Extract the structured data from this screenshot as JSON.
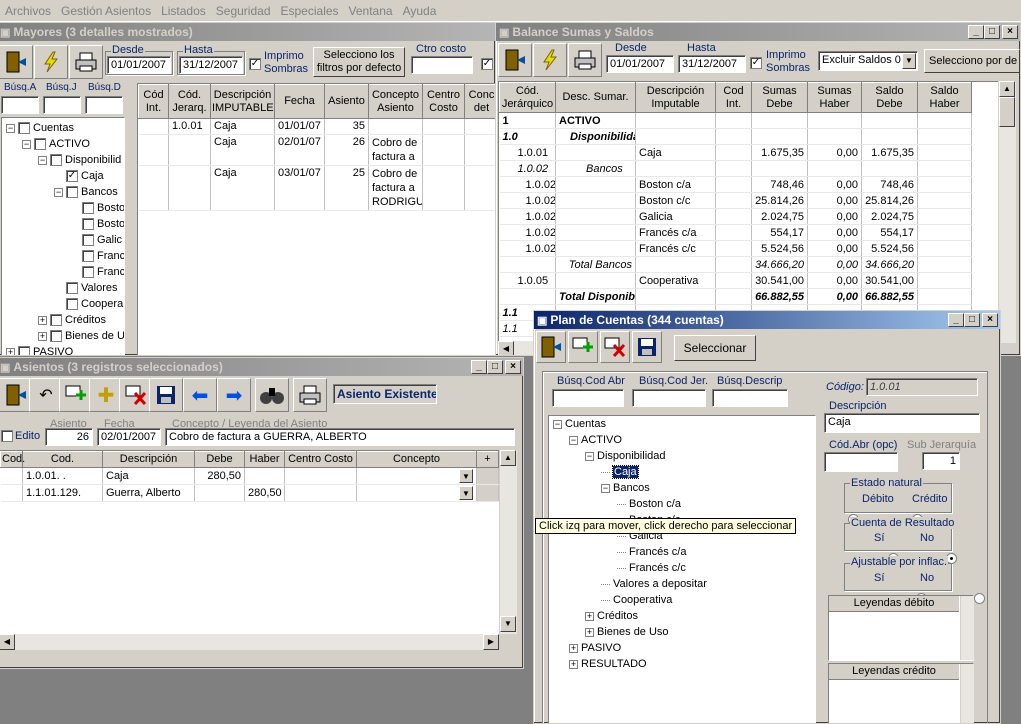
{
  "menu": [
    "Archivos",
    "Gestión Asientos",
    "Listados",
    "Seguridad",
    "Especiales",
    "Ventana",
    "Ayuda"
  ],
  "mayores": {
    "title": "Mayores (3 detalles mostrados)",
    "desde_label": "Desde",
    "desde": "01/01/2007",
    "hasta_label": "Hasta",
    "hasta": "31/12/2007",
    "imprimo_label": "Imprimo Sombras",
    "filtros_button": "Selecciono los filtros por defecto",
    "ctro_costo_label": "Ctro costo",
    "busq_labels": [
      "Búsq.A",
      "Búsq.J",
      "Búsq.D"
    ],
    "tree": [
      {
        "label": "Cuentas",
        "checked": false,
        "exp": "−"
      },
      {
        "label": "ACTIVO",
        "checked": false,
        "exp": "−"
      },
      {
        "label": "Disponibilid",
        "checked": false,
        "exp": "−"
      },
      {
        "label": "Caja",
        "checked": true,
        "exp": ""
      },
      {
        "label": "Bancos",
        "checked": false,
        "exp": "−"
      },
      {
        "label": "Bosto",
        "checked": false,
        "exp": ""
      },
      {
        "label": "Bosto",
        "checked": false,
        "exp": ""
      },
      {
        "label": "Galic",
        "checked": false,
        "exp": ""
      },
      {
        "label": "Franc",
        "checked": false,
        "exp": ""
      },
      {
        "label": "Franc",
        "checked": false,
        "exp": ""
      },
      {
        "label": "Valores",
        "checked": false,
        "exp": ""
      },
      {
        "label": "Coopera",
        "checked": false,
        "exp": ""
      },
      {
        "label": "Créditos",
        "checked": false,
        "exp": "+"
      },
      {
        "label": "Bienes de U",
        "checked": false,
        "exp": "+"
      },
      {
        "label": "PASIVO",
        "checked": false,
        "exp": "+"
      }
    ],
    "columns": [
      "Cód Int.",
      "Cód. Jerarq.",
      "Descripción IMPUTABLE",
      "Fecha",
      "Asiento",
      "Concepto Asiento",
      "Centro Costo",
      "Conc det"
    ],
    "rows": [
      {
        "int": "",
        "jer": "1.0.01",
        "desc": "Caja",
        "fecha": "01/01/07",
        "asiento": "35",
        "concepto": "",
        "centro": ""
      },
      {
        "int": "",
        "jer": "",
        "desc": "Caja",
        "fecha": "02/01/07",
        "asiento": "26",
        "concepto": "Cobro de factura a",
        "centro": ""
      },
      {
        "int": "",
        "jer": "",
        "desc": "Caja",
        "fecha": "03/01/07",
        "asiento": "25",
        "concepto": "Cobro de factura a RODRIGU",
        "centro": ""
      }
    ]
  },
  "balance": {
    "title": "Balance Sumas y Saldos",
    "desde_label": "Desde",
    "desde": "01/01/2007",
    "hasta_label": "Hasta",
    "hasta": "31/12/2007",
    "imprimo_label": "Imprimo Sombras",
    "excluir": "Excluir Saldos 0",
    "selecciono_button": "Selecciono por de",
    "columns": [
      "Cód. Jerárquico",
      "Desc. Sumar.",
      "Descripción Imputable",
      "Cod Int.",
      "Sumas Debe",
      "Sumas Haber",
      "Saldo Debe",
      "Saldo Haber"
    ],
    "rows": [
      {
        "cod": "1",
        "sumar": "ACTIVO",
        "imp": "",
        "int": "",
        "debe": "",
        "haber": "",
        "sdebe": "",
        "shaber": "",
        "style": "b"
      },
      {
        "cod": "1.0",
        "sumar": "Disponibilidad",
        "imp": "",
        "int": "",
        "debe": "",
        "haber": "",
        "sdebe": "",
        "shaber": "",
        "style": "bi"
      },
      {
        "cod": "1.0.01",
        "sumar": "",
        "imp": "Caja",
        "int": "",
        "debe": "1.675,35",
        "haber": "0,00",
        "sdebe": "1.675,35",
        "shaber": "",
        "style": ""
      },
      {
        "cod": "1.0.02",
        "sumar": "Bancos",
        "imp": "",
        "int": "",
        "debe": "",
        "haber": "",
        "sdebe": "",
        "shaber": "",
        "style": "i"
      },
      {
        "cod": "1.0.02.001",
        "sumar": "",
        "imp": "Boston c/a",
        "int": "",
        "debe": "748,46",
        "haber": "0,00",
        "sdebe": "748,46",
        "shaber": "",
        "style": ""
      },
      {
        "cod": "1.0.02.002",
        "sumar": "",
        "imp": "Boston c/c",
        "int": "",
        "debe": "25.814,26",
        "haber": "0,00",
        "sdebe": "25.814,26",
        "shaber": "",
        "style": ""
      },
      {
        "cod": "1.0.02.003",
        "sumar": "",
        "imp": "Galicia",
        "int": "",
        "debe": "2.024,75",
        "haber": "0,00",
        "sdebe": "2.024,75",
        "shaber": "",
        "style": ""
      },
      {
        "cod": "1.0.02.004",
        "sumar": "",
        "imp": "Francés c/a",
        "int": "",
        "debe": "554,17",
        "haber": "0,00",
        "sdebe": "554,17",
        "shaber": "",
        "style": ""
      },
      {
        "cod": "1.0.02.005",
        "sumar": "",
        "imp": "Francés c/c",
        "int": "",
        "debe": "5.524,56",
        "haber": "0,00",
        "sdebe": "5.524,56",
        "shaber": "",
        "style": ""
      },
      {
        "cod": "",
        "sumar": "Total Bancos",
        "imp": "",
        "int": "",
        "debe": "34.666,20",
        "haber": "0,00",
        "sdebe": "34.666,20",
        "shaber": "",
        "style": "i"
      },
      {
        "cod": "1.0.05",
        "sumar": "",
        "imp": "Cooperativa",
        "int": "",
        "debe": "30.541,00",
        "haber": "0,00",
        "sdebe": "30.541,00",
        "shaber": "",
        "style": ""
      },
      {
        "cod": "",
        "sumar": "Total Disponibilidad",
        "imp": "",
        "int": "",
        "debe": "66.882,55",
        "haber": "0,00",
        "sdebe": "66.882,55",
        "shaber": "",
        "style": "bi"
      },
      {
        "cod": "1.1",
        "sumar": "",
        "imp": "",
        "int": "",
        "debe": "",
        "haber": "",
        "sdebe": "",
        "shaber": "",
        "style": "bi"
      },
      {
        "cod": "1.1",
        "sumar": "",
        "imp": "",
        "int": "",
        "debe": "",
        "haber": "",
        "sdebe": "",
        "shaber": "",
        "style": "i"
      }
    ]
  },
  "asientos": {
    "title": "Asientos (3 registros seleccionados)",
    "status": "Asiento Existente",
    "edito_label": "Edito",
    "asiento_label": "Asiento",
    "asiento": "26",
    "fecha_label": "Fecha",
    "fecha": "02/01/2007",
    "concepto_label": "Concepto / Leyenda del Asiento",
    "concepto": "Cobro de factura a GUERRA, ALBERTO",
    "columns": [
      "Cod.",
      "Cod.",
      "Descripción",
      "Debe",
      "Haber",
      "Centro Costo",
      "Concepto",
      "+"
    ],
    "rows": [
      {
        "cod1": "",
        "cod2": "1.0.01. .",
        "desc": "Caja",
        "debe": "280,50",
        "haber": "",
        "extra": "02"
      },
      {
        "cod1": "",
        "cod2": "1.1.01.129.",
        "desc": "Guerra, Alberto",
        "debe": "",
        "haber": "280,50",
        "extra": "02"
      }
    ]
  },
  "plan": {
    "title": "Plan de Cuentas (344 cuentas)",
    "seleccionar_button": "Seleccionar",
    "busq_labels": [
      "Búsq.Cod Abr",
      "Búsq.Cod Jer.",
      "Búsq.Descrip"
    ],
    "codigo_label": "Código:",
    "codigo": "1.0.01",
    "descripcion_label": "Descripción",
    "descripcion": "Caja",
    "cod_abr_label": "Cód.Abr (opc)",
    "sub_jer_label": "Sub Jerarquía",
    "sub_jer": "1",
    "estado_label": "Estado natural",
    "estado_opts": [
      "Débito",
      "Crédito"
    ],
    "resultado_label": "Cuenta de Resultado",
    "si_no": [
      "Sí",
      "No"
    ],
    "ajustable_label": "Ajustable por inflac.",
    "leyendas_debito": "Leyendas débito",
    "leyendas_credito": "Leyendas crédito",
    "tooltip": "Click izq para mover, click derecho para seleccionar",
    "tree": [
      {
        "label": "Cuentas",
        "exp": "−",
        "lvl": 0
      },
      {
        "label": "ACTIVO",
        "exp": "−",
        "lvl": 1
      },
      {
        "label": "Disponibilidad",
        "exp": "−",
        "lvl": 2
      },
      {
        "label": "Caja",
        "exp": "",
        "lvl": 3
      },
      {
        "label": "Bancos",
        "exp": "−",
        "lvl": 3
      },
      {
        "label": "Boston c/a",
        "exp": "",
        "lvl": 4
      },
      {
        "label": "Boston c/c",
        "exp": "",
        "lvl": 4
      },
      {
        "label": "Galicia",
        "exp": "",
        "lvl": 4
      },
      {
        "label": "Francés c/a",
        "exp": "",
        "lvl": 4
      },
      {
        "label": "Francés c/c",
        "exp": "",
        "lvl": 4
      },
      {
        "label": "Valores a depositar",
        "exp": "",
        "lvl": 3
      },
      {
        "label": "Cooperativa",
        "exp": "",
        "lvl": 3
      },
      {
        "label": "Créditos",
        "exp": "+",
        "lvl": 2
      },
      {
        "label": "Bienes de Uso",
        "exp": "+",
        "lvl": 2
      },
      {
        "label": "PASIVO",
        "exp": "+",
        "lvl": 1
      },
      {
        "label": "RESULTADO",
        "exp": "+",
        "lvl": 1
      }
    ]
  }
}
